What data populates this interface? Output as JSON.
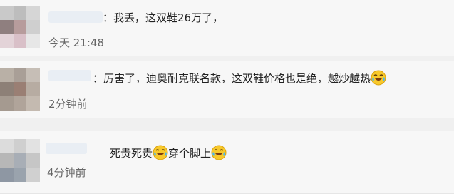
{
  "comments": [
    {
      "text_main": "：我丢，这双鞋26万了，",
      "time": "今天 21:48"
    },
    {
      "text_main": "：厉害了，迪奥耐克联名款，这双鞋价格也是绝，越炒越热",
      "time": "2分钟前"
    },
    {
      "text_a": "死贵死贵",
      "text_b": "穿个脚上",
      "time": "4分钟前"
    }
  ],
  "icons": {
    "laugh_cry": "laughing-crying-emoji"
  },
  "colors": {
    "card_bg": "#f7f7f7",
    "gap_bg": "#f0f0f0",
    "text": "#222222",
    "time_text": "#666666",
    "name_placeholder": "#e9eef4"
  }
}
